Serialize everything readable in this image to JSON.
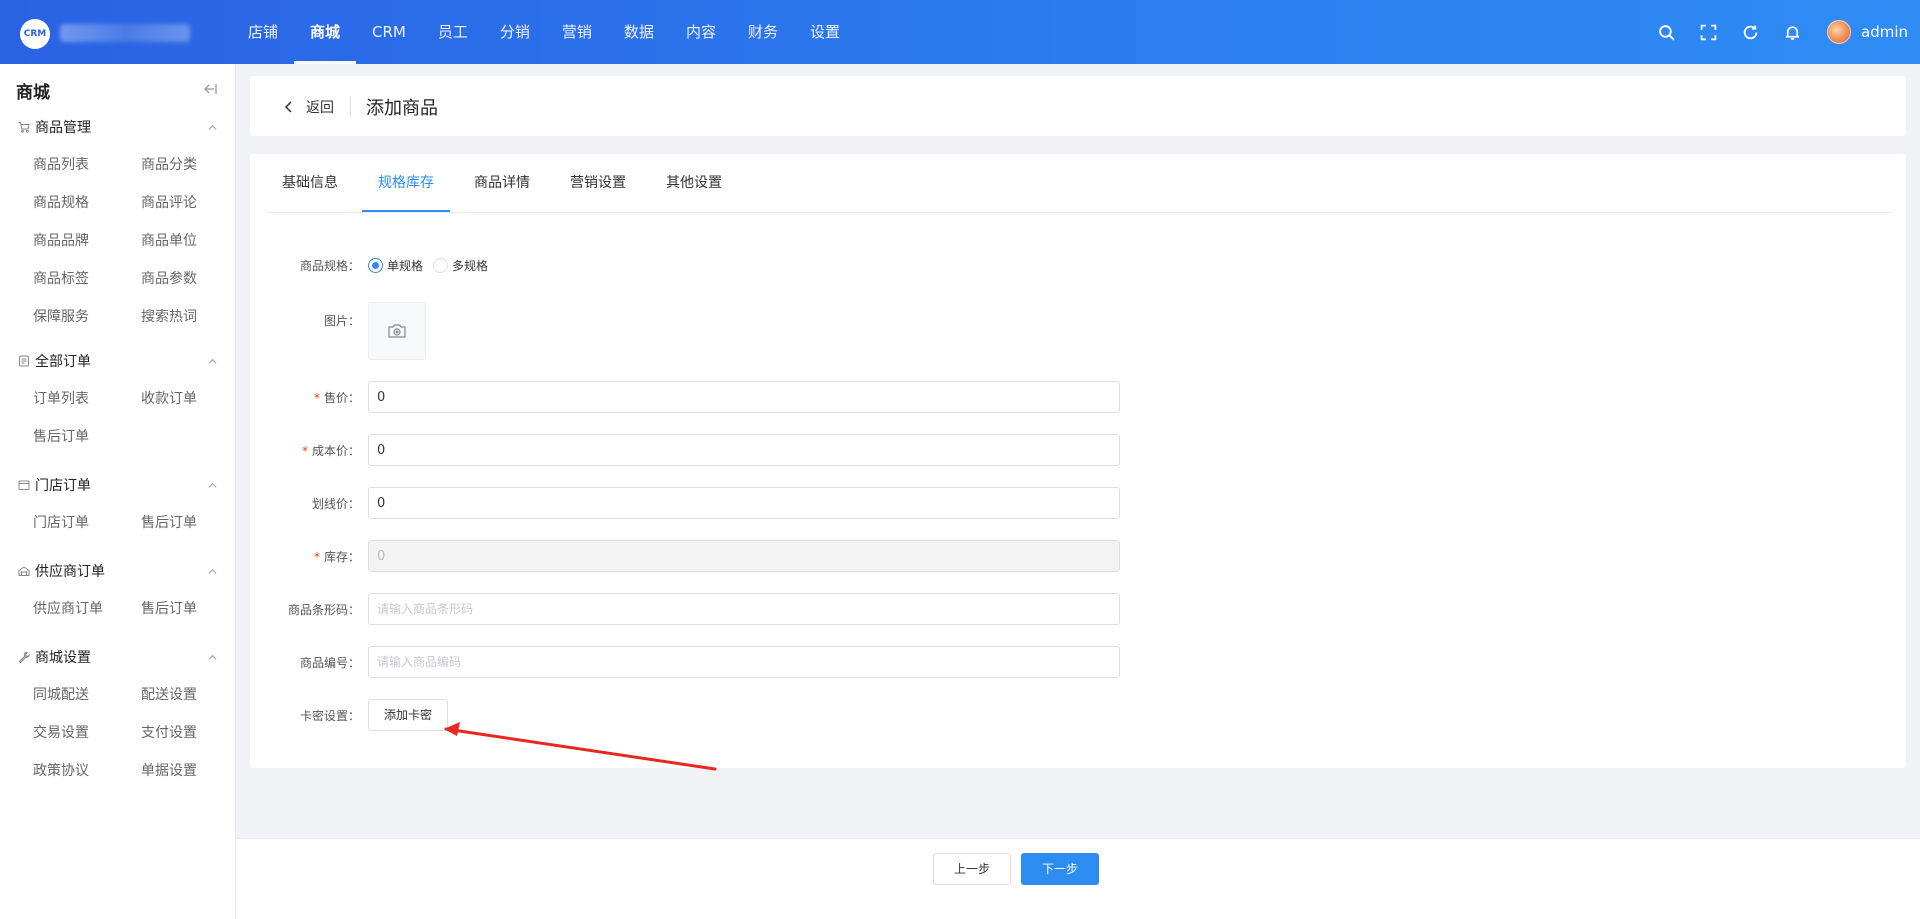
{
  "app": {
    "logo_text": "CRM"
  },
  "topnav": {
    "items": [
      "店铺",
      "商城",
      "CRM",
      "员工",
      "分销",
      "营销",
      "数据",
      "内容",
      "财务",
      "设置"
    ],
    "active_index": 1,
    "user": "admin"
  },
  "sidebar": {
    "title": "商城",
    "groups": [
      {
        "label": "商品管理",
        "items": [
          "商品列表",
          "商品分类",
          "商品规格",
          "商品评论",
          "商品品牌",
          "商品单位",
          "商品标签",
          "商品参数",
          "保障服务",
          "搜索热词"
        ]
      },
      {
        "label": "全部订单",
        "items": [
          "订单列表",
          "收款订单",
          "售后订单"
        ]
      },
      {
        "label": "门店订单",
        "items": [
          "门店订单",
          "售后订单"
        ]
      },
      {
        "label": "供应商订单",
        "items": [
          "供应商订单",
          "售后订单"
        ]
      },
      {
        "label": "商城设置",
        "items": [
          "同城配送",
          "配送设置",
          "交易设置",
          "支付设置",
          "政策协议",
          "单据设置"
        ]
      }
    ]
  },
  "header": {
    "back_label": "返回",
    "title": "添加商品"
  },
  "tabs": {
    "items": [
      "基础信息",
      "规格库存",
      "商品详情",
      "营销设置",
      "其他设置"
    ],
    "active_index": 1
  },
  "form": {
    "spec": {
      "label": "商品规格：",
      "options": [
        "单规格",
        "多规格"
      ],
      "selected": "单规格"
    },
    "image": {
      "label": "图片："
    },
    "price": {
      "label": "售价：",
      "value": "0",
      "required": "*"
    },
    "cost": {
      "label": "成本价：",
      "value": "0",
      "required": "*"
    },
    "strike": {
      "label": "划线价：",
      "value": "0"
    },
    "stock": {
      "label": "库存：",
      "value": "0",
      "required": "*"
    },
    "barcode": {
      "label": "商品条形码：",
      "placeholder": "请输入商品条形码"
    },
    "code": {
      "label": "商品编号：",
      "placeholder": "请输入商品编码"
    },
    "card": {
      "label": "卡密设置：",
      "button": "添加卡密"
    }
  },
  "footer": {
    "prev": "上一步",
    "next": "下一步"
  },
  "colors": {
    "primary": "#2d8cf0",
    "topbar": "#2a62e4",
    "required": "#ed4014",
    "annotation_arrow": "#e8271f"
  }
}
